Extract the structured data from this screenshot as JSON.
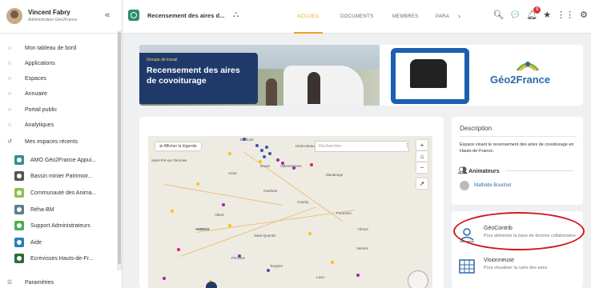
{
  "user": {
    "name": "Vincent Fabry",
    "role": "Administrateur Géo2France"
  },
  "sidebar": {
    "collapse_icon": "«",
    "nav": [
      {
        "label": "Mon tableau de bord",
        "icon": "circle-icon"
      },
      {
        "label": "Applications",
        "icon": "circle-icon"
      },
      {
        "label": "Espaces",
        "icon": "circle-icon"
      },
      {
        "label": "Annuaire",
        "icon": "circle-icon"
      },
      {
        "label": "Portail public",
        "icon": "circle-icon"
      },
      {
        "label": "Analytiques",
        "icon": "circle-icon"
      },
      {
        "label": "Mes espaces récents",
        "icon": "history-icon"
      }
    ],
    "spaces": [
      {
        "label": "AMO Géo2France Appui...",
        "color": "#3a8c9c"
      },
      {
        "label": "Bassin minier Patrimoir...",
        "color": "#555"
      },
      {
        "label": "Communauté des Anima...",
        "color": "#8bc34a"
      },
      {
        "label": "Réha-BM",
        "color": "#607d8b"
      },
      {
        "label": "Support Administrateurs",
        "color": "#4caf50"
      },
      {
        "label": "Aide",
        "color": "#2c7cc0"
      },
      {
        "label": "Ecrevisses Hauts-de-Fr...",
        "color": "#2e6b3a"
      }
    ],
    "settings": "Paramètres"
  },
  "topbar": {
    "space_title": "Recensement des aires d...",
    "tabs": [
      "ACCUEIL",
      "DOCUMENTS",
      "MEMBRES",
      "PARA"
    ],
    "active_tab": 0,
    "notif_count": "5"
  },
  "banner": {
    "kicker": "Groupe de travail",
    "title": "Recensement des aires de covoiturage",
    "logo_text": "Géo2France"
  },
  "map": {
    "legend_button": "Afficher la légende",
    "search_placeholder": "Rechercher",
    "places": [
      "Béthune",
      "Douai",
      "Valenciennes",
      "Maubeuge",
      "Arras",
      "Cambrai",
      "Caudry",
      "Fourmies",
      "Saint-Pol-sur-Ternoise",
      "Albert",
      "AMIENS",
      "Saint-Quentin",
      "Hirson",
      "Péronne",
      "Vervins",
      "Tergnier",
      "Laon",
      "Henin-Beaumont"
    ],
    "controls": [
      "+",
      "⌂",
      "−",
      "➚"
    ]
  },
  "description": {
    "heading": "Description",
    "text": "Espace visant le recensement des aires de covoiturage en Hauts-de-France.",
    "animators_heading": "Animateurs",
    "animator": "Mathilde Bouchet"
  },
  "tools": [
    {
      "name": "GéoContrib",
      "desc": "Pour alimenter la base de donnée collaborative",
      "icon": "geocontrib-icon"
    },
    {
      "name": "Visionneuse",
      "desc": "Pour visualiser la carte des aires",
      "icon": "map-viewer-icon"
    }
  ],
  "colors": {
    "accent": "#f0a020",
    "brand": "#1f3a6a",
    "annotation": "#d01818"
  }
}
